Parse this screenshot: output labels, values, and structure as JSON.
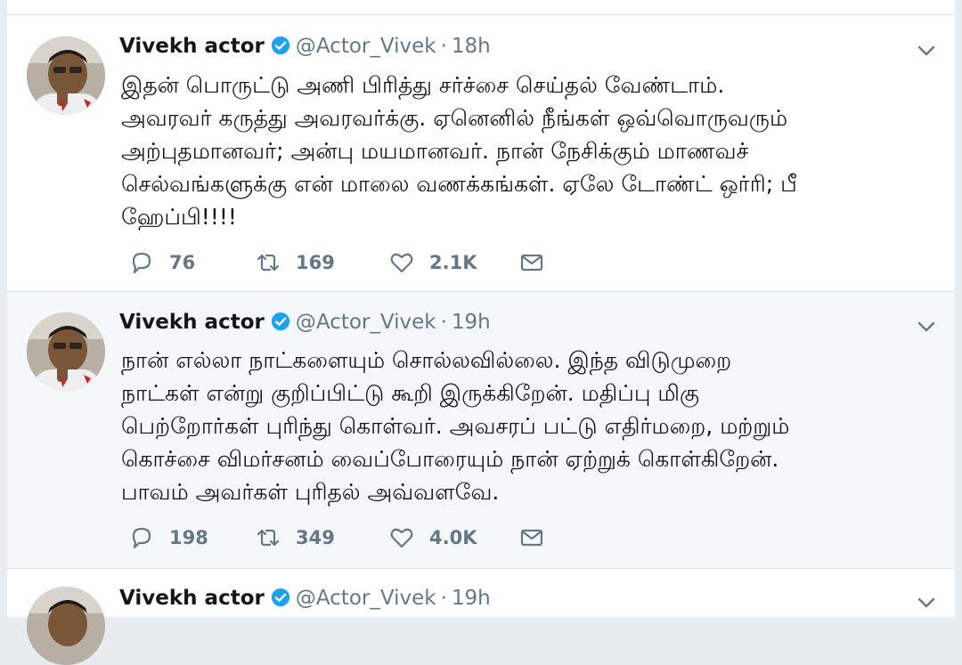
{
  "tweets": [
    {
      "name": "Vivekh actor",
      "handle": "@Actor_Vivek",
      "separator": "·",
      "time": "18h",
      "text": "இதன் பொருட்டு அணி பிரித்து சர்ச்சை செய்தல் வேண்டாம்.\nஅவரவர் கருத்து அவரவர்க்கு. ஏனெனில் நீங்கள் ஒவ்வொருவரும்\nஅற்புதமானவர்; அன்பு மயமானவர். நான்  நேசிக்கும் மாணவச்\nசெல்வங்களுக்கு  என் மாலை வணக்கங்கள். ஏலே டோண்ட் ஒர்ரி; பீ\nஹேப்பி!!!!",
      "replies": "76",
      "retweets": "169",
      "likes": "2.1K"
    },
    {
      "name": "Vivekh actor",
      "handle": "@Actor_Vivek",
      "separator": "·",
      "time": "19h",
      "text": "நான் எல்லா நாட்களையும் சொல்லவில்லை. இந்த விடுமுறை\nநாட்கள் என்று குறிப்பிட்டு கூறி இருக்கிறேன். மதிப்பு மிகு\nபெற்றோர்கள் புரிந்து கொள்வர். அவசரப் பட்டு எதிர்மறை, மற்றும்\nகொச்சை விமர்சனம் வைப்போரையும் நான் ஏற்றுக் கொள்கிறேன்.\nபாவம் அவர்கள் புரிதல் அவ்வளவே.",
      "replies": "198",
      "retweets": "349",
      "likes": "4.0K"
    },
    {
      "name": "Vivekh actor",
      "handle": "@Actor_Vivek",
      "separator": "·",
      "time": "19h"
    }
  ],
  "colors": {
    "text": "#14171a",
    "muted": "#657786",
    "verified": "#1da1f2",
    "hover_bg": "#f5f8fa",
    "page_bg": "#e6ecf0"
  },
  "icons": {
    "verified": "verified-badge-icon",
    "menu": "chevron-down-icon",
    "reply": "reply-icon",
    "retweet": "retweet-icon",
    "like": "heart-icon",
    "dm": "envelope-icon"
  }
}
